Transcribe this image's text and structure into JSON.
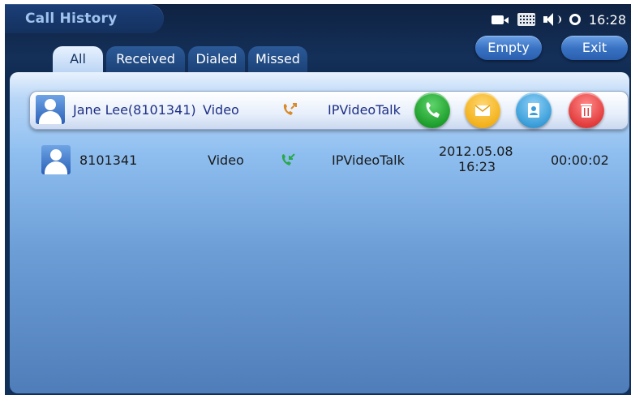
{
  "app": {
    "title": "Call History"
  },
  "status_bar": {
    "icons": [
      "camera-icon",
      "keyboard-icon",
      "speaker-icon",
      "sync-icon"
    ],
    "time": "16:28"
  },
  "header": {
    "empty_label": "Empty",
    "exit_label": "Exit"
  },
  "tabs": [
    {
      "label": "All",
      "active": true
    },
    {
      "label": "Received",
      "active": false
    },
    {
      "label": "Dialed",
      "active": false
    },
    {
      "label": "Missed",
      "active": false
    }
  ],
  "calls": [
    {
      "name": "Jane Lee(8101341)",
      "media": "Video",
      "direction_icon": "outgoing-call-icon",
      "account": "IPVideoTalk",
      "selected": true,
      "actions": [
        "call-icon",
        "message-icon",
        "contact-icon",
        "delete-icon"
      ]
    },
    {
      "name": "8101341",
      "media": "Video",
      "direction_icon": "received-call-icon",
      "account": "IPVideoTalk",
      "date": "2012.05.08",
      "time": "16:23",
      "duration": "00:00:02",
      "selected": false
    }
  ],
  "colors": {
    "background": "#10305a",
    "selected_text": "#1d2f86",
    "call_green": "#1e9f2c",
    "message_yellow": "#f3b21c",
    "contact_blue": "#3a9ed9",
    "delete_red": "#e33c3c",
    "outgoing_orange": "#d98a2a",
    "received_green": "#2aa84a"
  }
}
